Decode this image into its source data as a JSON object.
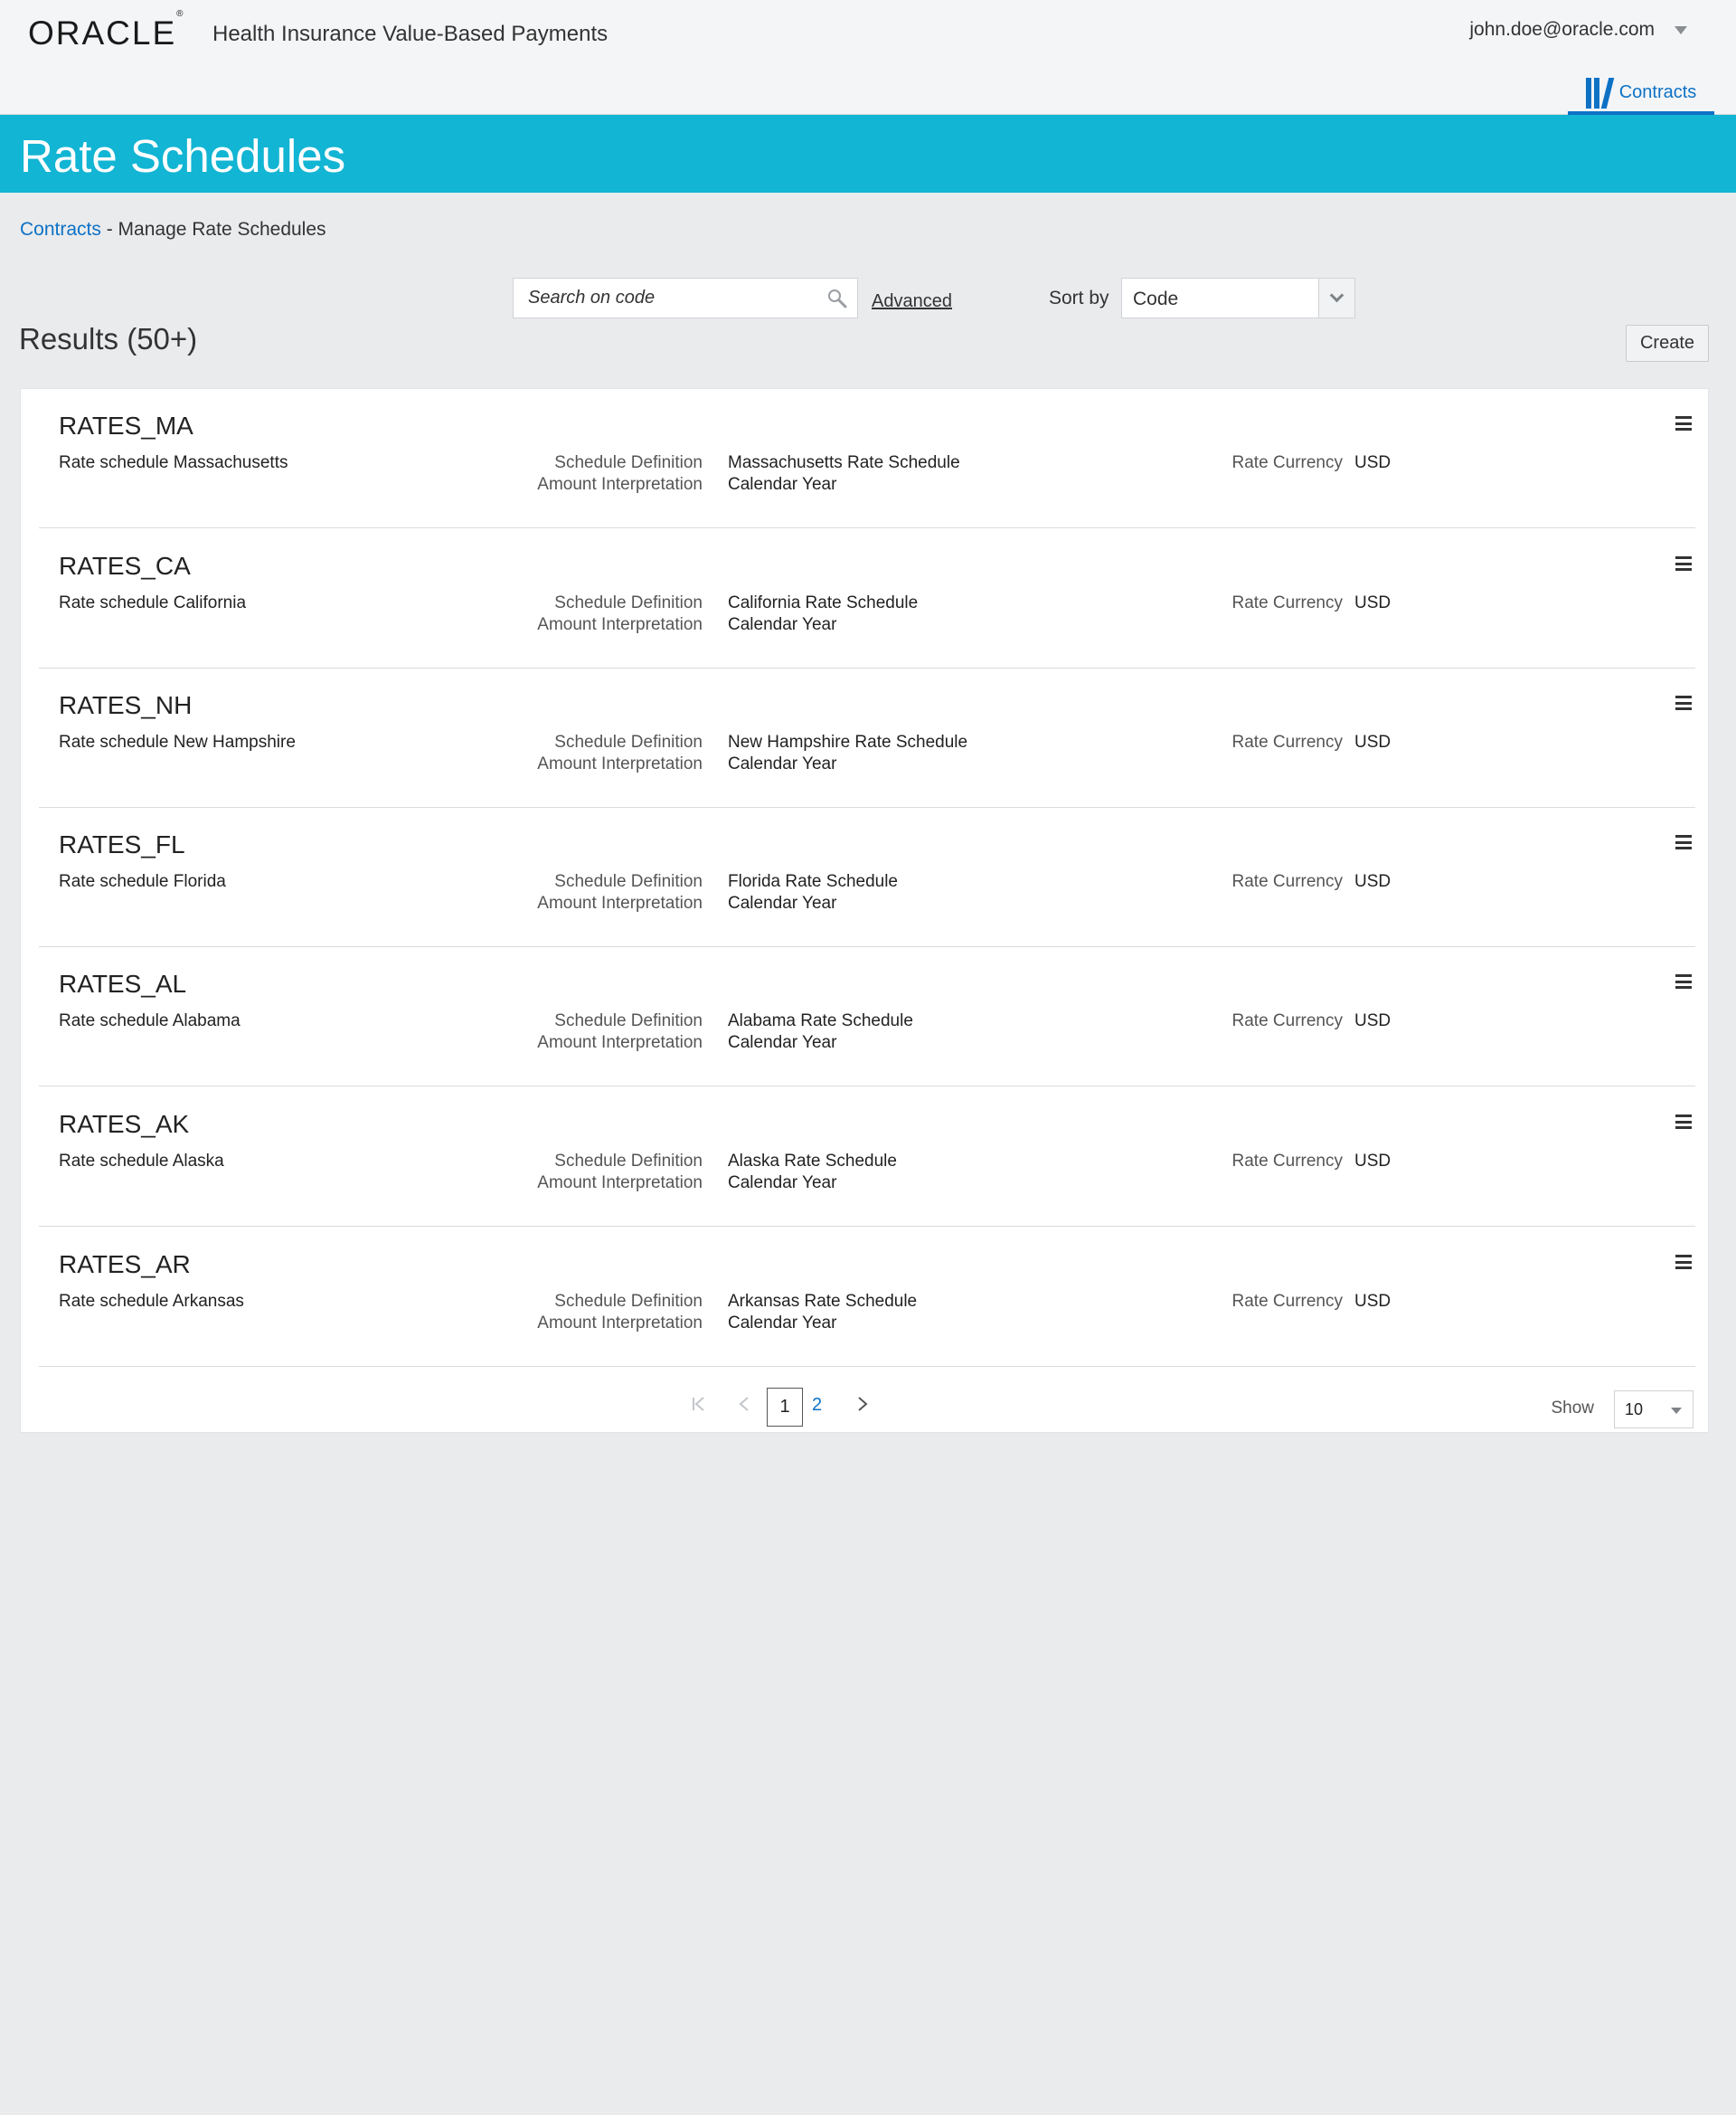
{
  "header": {
    "logo_text": "ORACLE",
    "app_title": "Health Insurance Value-Based Payments",
    "user": "john.doe@oracle.com",
    "nav_tab_label": "Contracts"
  },
  "page": {
    "title": "Rate Schedules",
    "breadcrumb_link": "Contracts",
    "breadcrumb_rest": " - Manage Rate Schedules"
  },
  "search": {
    "placeholder": "Search on code",
    "advanced_label": "Advanced",
    "sort_label": "Sort by",
    "sort_value": "Code"
  },
  "results": {
    "title": "Results (50+)",
    "create_label": "Create",
    "labels": {
      "schedule_definition": "Schedule Definition",
      "amount_interpretation": "Amount Interpretation",
      "rate_currency": "Rate Currency"
    },
    "rows": [
      {
        "code": "RATES_MA",
        "description": "Rate schedule Massachusetts",
        "schedule_definition": "Massachusetts Rate Schedule",
        "amount_interpretation": "Calendar Year",
        "rate_currency": "USD",
        "rate_currency_label": "Rate Currency"
      },
      {
        "code": "RATES_CA",
        "description": "Rate schedule  California",
        "schedule_definition": "California Rate Schedule",
        "amount_interpretation": "Calendar Year",
        "rate_currency": "USD",
        "rate_currency_label": "Rate Currency"
      },
      {
        "code": "RATES_NH",
        "description": "Rate schedule New Hampshire",
        "schedule_definition": "New Hampshire Rate Schedule",
        "amount_interpretation": "Calendar Year",
        "rate_currency": "USD",
        "rate_currency_label": "Rate Currency"
      },
      {
        "code": "RATES_FL",
        "description": "Rate schedule Florida",
        "schedule_definition": "Florida Rate Schedule",
        "amount_interpretation": "Calendar Year",
        "rate_currency": "USD",
        "rate_currency_label": "Rate Currency"
      },
      {
        "code": "RATES_AL",
        "description": "Rate schedule Alabama",
        "schedule_definition": "Alabama Rate Schedule",
        "amount_interpretation": "Calendar Year",
        "rate_currency": "USD",
        "rate_currency_label": "Rate  Currency"
      },
      {
        "code": "RATES_AK",
        "description": "Rate schedule Alaska",
        "schedule_definition": "Alaska Rate Schedule",
        "amount_interpretation": "Calendar Year",
        "rate_currency": "USD",
        "rate_currency_label": "Rate  Currency"
      },
      {
        "code": "RATES_AR",
        "description": "Rate schedule Arkansas",
        "schedule_definition": "Arkansas Rate Schedule",
        "amount_interpretation": "Calendar Year",
        "rate_currency": "USD",
        "rate_currency_label": "Rate Currency"
      }
    ]
  },
  "pagination": {
    "first_icon": "first-page-icon",
    "prev_icon": "prev-page-icon",
    "current_page": "1",
    "next_page": "2",
    "next_icon": "next-page-icon",
    "show_label": "Show",
    "page_size": "10"
  },
  "colors": {
    "banner": "#12b5d3",
    "accent": "#0d72c6"
  }
}
